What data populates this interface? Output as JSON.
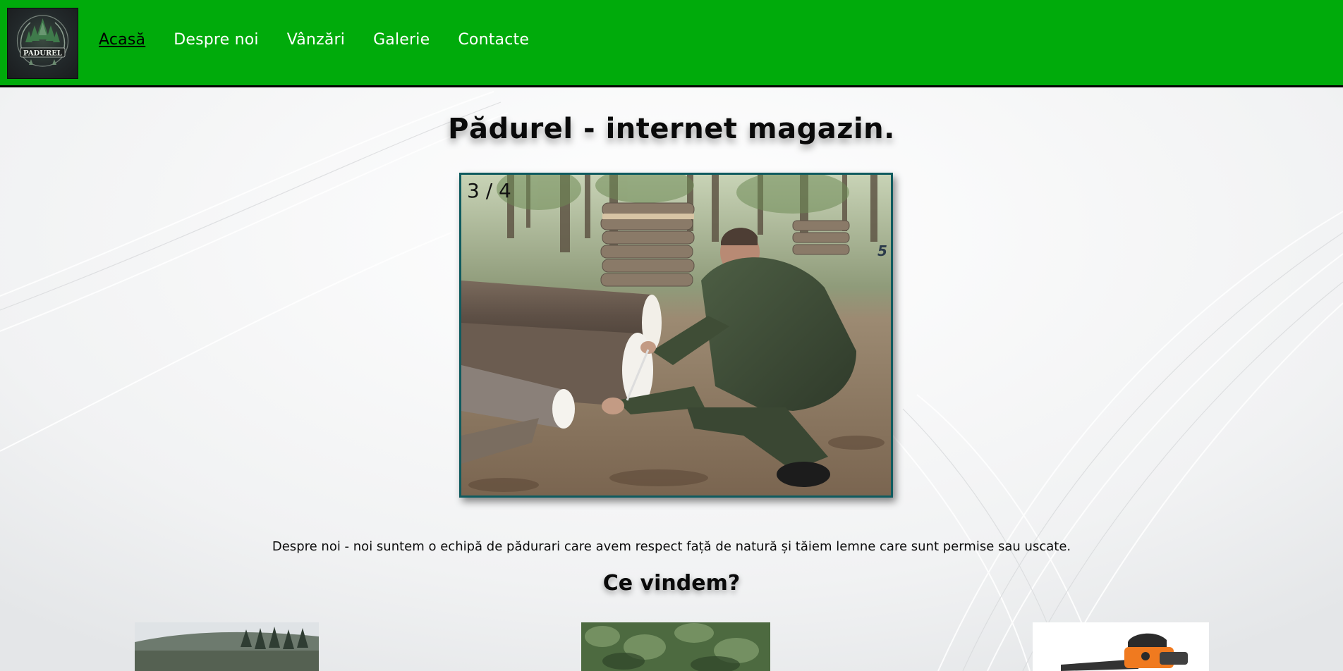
{
  "nav": {
    "logo_text": "PADUREL",
    "items": [
      {
        "label": "Acasă",
        "active": true
      },
      {
        "label": "Despre noi",
        "active": false
      },
      {
        "label": "Vânzări",
        "active": false
      },
      {
        "label": "Galerie",
        "active": false
      },
      {
        "label": "Contacte",
        "active": false
      }
    ]
  },
  "main": {
    "title": "Pădurel - internet magazin.",
    "slideshow": {
      "counter": "3 / 4",
      "current": 3,
      "total": 4
    },
    "about": "Despre noi - noi suntem o echipă de pădurari care avem respect față de natură și tăiem lemne care sunt permise sau uscate.",
    "products_title": "Ce vindem?"
  },
  "colors": {
    "nav_background": "#00ab0b",
    "nav_border": "#000000",
    "slideshow_border": "#0f5b5f",
    "page_background": "#f4f5f6"
  }
}
